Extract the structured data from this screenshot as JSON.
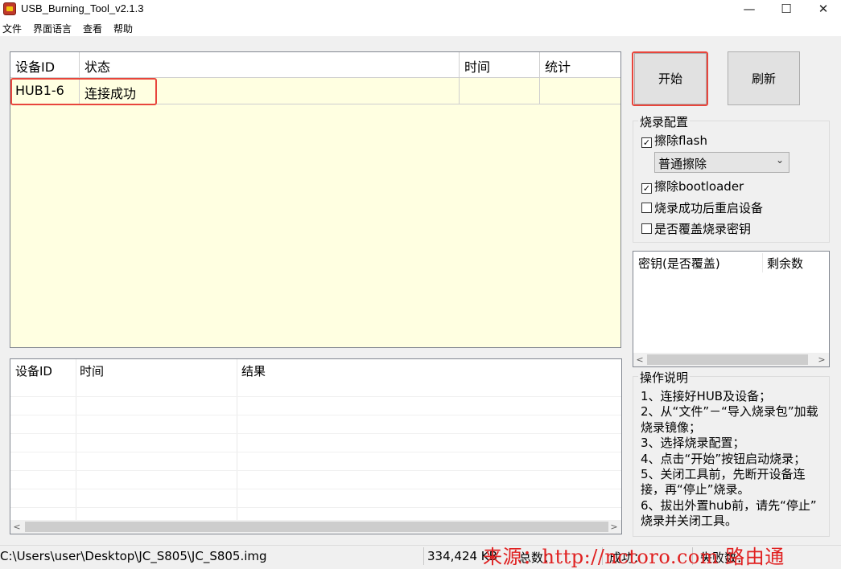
{
  "window": {
    "title": "USB_Burning_Tool_v2.1.3",
    "minimize_glyph": "—",
    "maximize_glyph": "☐",
    "close_glyph": "✕"
  },
  "menu": [
    "文件",
    "界面语言",
    "查看",
    "帮助"
  ],
  "device_grid": {
    "headers": [
      "设备ID",
      "状态",
      "时间",
      "统计"
    ],
    "rows": [
      {
        "id": "HUB1-6",
        "status": "连接成功",
        "time": "",
        "stats": ""
      }
    ]
  },
  "buttons": {
    "start": "开始",
    "refresh": "刷新"
  },
  "burn_config": {
    "title": "烧录配置",
    "erase_flash": {
      "label": "擦除flash",
      "checked": true
    },
    "erase_mode": "普通擦除",
    "erase_bootloader": {
      "label": "擦除bootloader",
      "checked": true
    },
    "reboot_after": {
      "label": "烧录成功后重启设备",
      "checked": false
    },
    "overwrite_key": {
      "label": "是否覆盖烧录密钥",
      "checked": false
    }
  },
  "key_list": {
    "headers": [
      "密钥(是否覆盖)",
      "剩余数"
    ]
  },
  "result_grid": {
    "headers": [
      "设备ID",
      "时间",
      "结果"
    ]
  },
  "instructions": {
    "title": "操作说明",
    "lines": [
      "1、连接好HUB及设备；",
      "2、从“文件”－“导入烧录包”加载",
      "烧录镜像；",
      "3、选择烧录配置；",
      "4、点击“开始”按钮启动烧录；",
      "5、关闭工具前，先断开设备连",
      "接，再“停止”烧录。",
      "6、拔出外置hub前，请先“停止”",
      "烧录并关闭工具。"
    ]
  },
  "status_bar": {
    "path": "C:\\Users\\user\\Desktop\\JC_S805\\JC_S805.img",
    "size": "334,424 KB",
    "total_label": "总数：",
    "success_label": "成功：",
    "fail_label": "失败数："
  },
  "watermark": "来源：http://nctoro.com 路由通"
}
